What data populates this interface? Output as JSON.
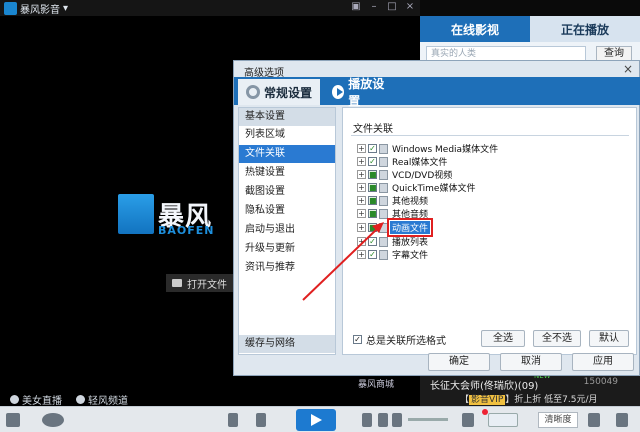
{
  "player": {
    "app_name": "暴风影音",
    "brand_cn": "暴风",
    "brand_en": "BAOFEN",
    "open_file": "打开文件",
    "link_beauty": "美女直播",
    "link_light": "轻风频道",
    "shop": "暴风商城",
    "quality": "清晰度"
  },
  "right_panel": {
    "tab_online": "在线影视",
    "tab_playing": "正在播放",
    "search_placeholder": "真实的人类",
    "search_button": "查询",
    "playlist_title": "长征大会师(佟瑞欣)(09)",
    "playlist_badge": "NEW",
    "playlist_count": "150049",
    "vip_prefix": "【",
    "vip_badge": "影音VIP",
    "vip_text": "】折上折  低至7.5元/月"
  },
  "dialog": {
    "title": "高级选项",
    "close": "×",
    "tab_general": "常规设置",
    "tab_playback": "播放设置",
    "sidebar": {
      "header": "基本设置",
      "items": [
        "列表区域",
        "文件关联",
        "热键设置",
        "截图设置",
        "隐私设置",
        "启动与退出",
        "升级与更新",
        "资讯与推荐"
      ],
      "footer": "缓存与网络"
    },
    "content_title": "文件关联",
    "tree": [
      {
        "label": "Windows Media媒体文件"
      },
      {
        "label": "Real媒体文件"
      },
      {
        "label": "VCD/DVD视频"
      },
      {
        "label": "QuickTime媒体文件"
      },
      {
        "label": "其他视频"
      },
      {
        "label": "其他音频"
      },
      {
        "label": "动画文件"
      },
      {
        "label": "播放列表"
      },
      {
        "label": "字幕文件"
      }
    ],
    "always_assoc": "总是关联所选格式",
    "btn_select_all": "全选",
    "btn_select_none": "全不选",
    "btn_default": "默认",
    "btn_ok": "确定",
    "btn_cancel": "取消",
    "btn_apply": "应用"
  },
  "colors": {
    "accent": "#1e6fb8",
    "selection": "#2a7ad2",
    "annotation": "#e02020"
  }
}
